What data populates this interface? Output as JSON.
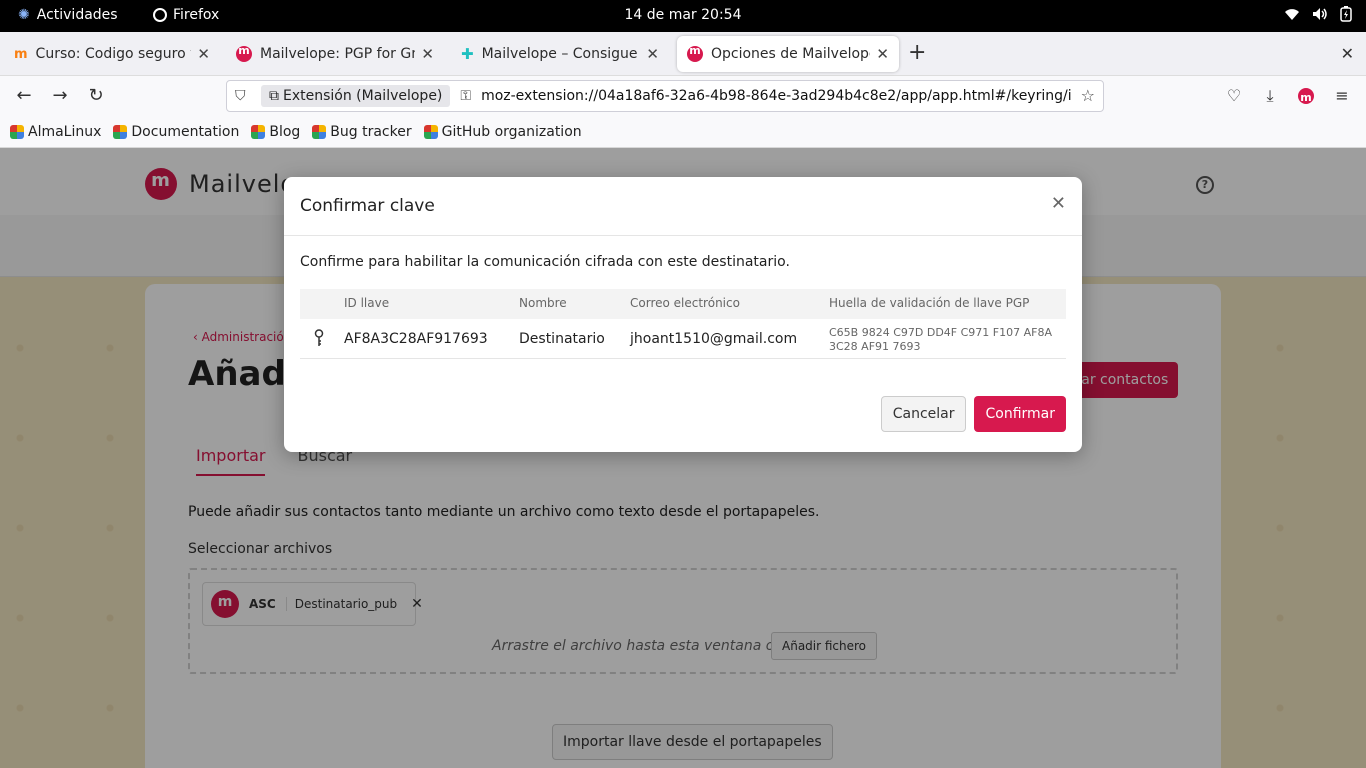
{
  "system": {
    "activities": "Actividades",
    "app_name": "Firefox",
    "clock": "14 de mar  20:54"
  },
  "tabs": [
    {
      "title": "Curso: Codigo seguro y ge",
      "icon": "moodle-icon"
    },
    {
      "title": "Mailvelope: PGP for Gmai",
      "icon": "mailvelope-icon"
    },
    {
      "title": "Mailvelope – Consigue est",
      "icon": "puzzle-icon"
    },
    {
      "title": "Opciones de Mailvelope",
      "icon": "mailvelope-icon"
    }
  ],
  "urlbar": {
    "extension_label": "Extensión (Mailvelope)",
    "url": "moz-extension://04a18af6-32a6-4b98-864e-3ad294b4c8e2/app/app.html#/keyring/im"
  },
  "bookmarks": [
    "AlmaLinux",
    "Documentation",
    "Blog",
    "Bug tracker",
    "GitHub organization"
  ],
  "page": {
    "logo_text": "Mailvelo",
    "breadcrumb": "Administració",
    "title": "Añadi",
    "export_button": "rtar contactos",
    "tab_import": "Importar",
    "tab_search": "Buscar",
    "description": "Puede añadir sus contactos tanto mediante un archivo como texto desde el portapapeles.",
    "select_files_label": "Seleccionar archivos",
    "file": {
      "ext": "ASC",
      "name": "Destinatario_pub"
    },
    "drop_text": "Arrastre el archivo hasta esta ventana o",
    "add_file_button": "Añadir fichero",
    "clipboard_button": "Importar llave desde el portapapeles"
  },
  "modal": {
    "title": "Confirmar clave",
    "message": "Confirme para habilitar la comunicación cifrada con este destinatario.",
    "columns": {
      "key_id": "ID llave",
      "name": "Nombre",
      "email": "Correo electrónico",
      "fingerprint": "Huella de validación de llave PGP"
    },
    "row": {
      "key_id": "AF8A3C28AF917693",
      "name": "Destinatario",
      "email": "jhoant1510@gmail.com",
      "fingerprint": "C65B 9824 C97D DD4F C971 F107 AF8A 3C28 AF91 7693"
    },
    "cancel_label": "Cancelar",
    "confirm_label": "Confirmar"
  },
  "colors": {
    "accent": "#d7194e",
    "page_bg": "#f3e7c2"
  }
}
